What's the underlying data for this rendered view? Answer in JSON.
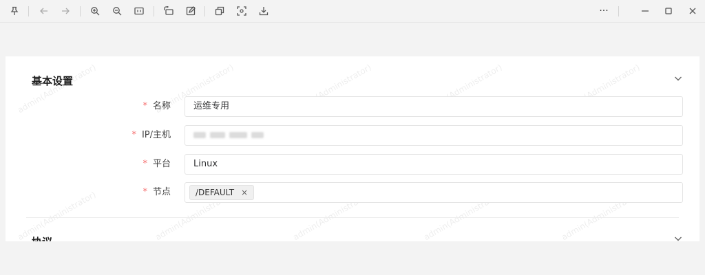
{
  "toolbar": {
    "icons": [
      "pin-icon",
      "back-icon",
      "forward-icon",
      "zoom-in-icon",
      "zoom-out-icon",
      "fit-icon",
      "rotate-icon",
      "edit-icon",
      "copy-icon",
      "screenshot-icon",
      "save-icon"
    ],
    "more_label": "···"
  },
  "basic": {
    "title": "基本设置",
    "fields": [
      {
        "label": "名称",
        "required": "*",
        "value": "运维专用"
      },
      {
        "label": "IP/主机",
        "required": "*",
        "value": ""
      },
      {
        "label": "平台",
        "required": "*",
        "value": "Linux"
      },
      {
        "label": "节点",
        "required": "*",
        "tag": "/DEFAULT",
        "tag_close": "×"
      }
    ]
  },
  "protocol": {
    "title": "协议"
  },
  "watermark": "admin(Administrator)"
}
